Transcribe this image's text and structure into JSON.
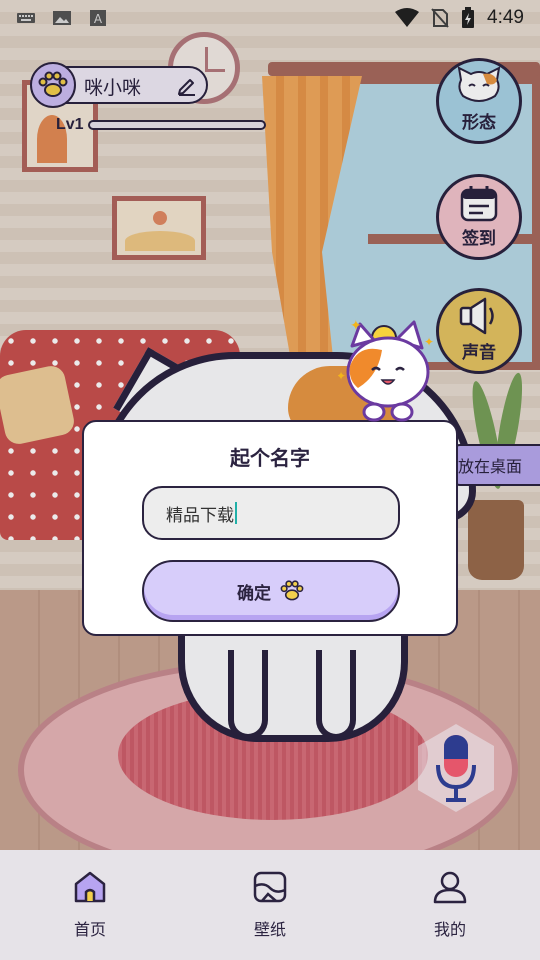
{
  "status_bar": {
    "time": "4:49",
    "icons": [
      "keyboard-icon",
      "image-icon",
      "font-icon",
      "wifi-icon",
      "no-sim-icon",
      "battery-charging-icon"
    ]
  },
  "profile": {
    "name": "咪小咪",
    "level": "Lv1",
    "level_progress": 0.0
  },
  "side_buttons": {
    "form": "形态",
    "sign": "签到",
    "sound": "声音",
    "desktop_chip": "放在桌面"
  },
  "dialog": {
    "title": "起个名字",
    "input_value": "精品下载",
    "confirm_label": "确定"
  },
  "bottom_nav": {
    "items": [
      {
        "label": "首页",
        "icon": "home-icon"
      },
      {
        "label": "壁纸",
        "icon": "wallpaper-icon"
      },
      {
        "label": "我的",
        "icon": "profile-icon"
      }
    ]
  },
  "colors": {
    "outline": "#2b2340",
    "accent_purple": "#d7cdfa",
    "form_button": "#a9d3e6",
    "sign_button": "#f2c4cc",
    "sound_button": "#e5c462"
  }
}
